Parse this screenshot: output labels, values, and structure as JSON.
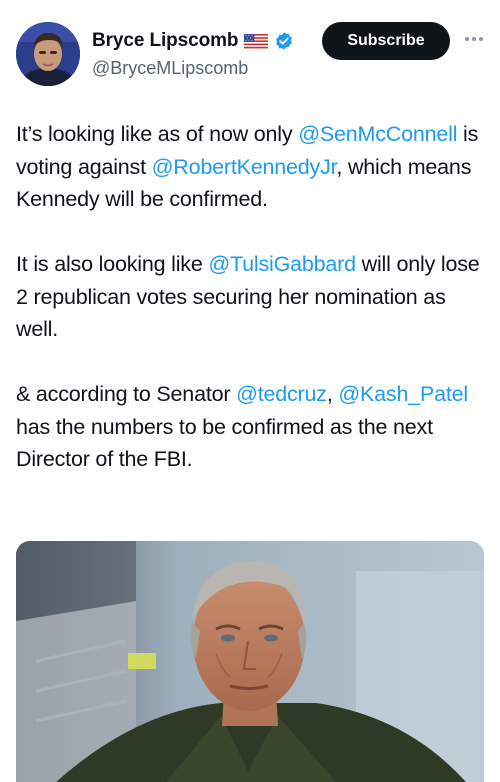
{
  "author": {
    "display_name": "Bryce Lipscomb",
    "handle": "@BryceMLipscomb",
    "flag_icon": "us-flag-icon",
    "verified_icon": "verified-badge-icon",
    "verified_color": "#1d9bf0"
  },
  "actions": {
    "subscribe_label": "Subscribe",
    "more_icon": "more-options-icon"
  },
  "tweet": {
    "paragraphs": [
      [
        {
          "text": "It’s looking like as of now only ",
          "mention": false
        },
        {
          "text": "@SenMcConnell",
          "mention": true
        },
        {
          "text": " is voting against ",
          "mention": false
        },
        {
          "text": "@RobertKennedyJr",
          "mention": true
        },
        {
          "text": ", which means Kennedy will be confirmed.",
          "mention": false
        }
      ],
      [
        {
          "text": "It is also looking like ",
          "mention": false
        },
        {
          "text": "@TulsiGabbard",
          "mention": true
        },
        {
          "text": " will only lose 2 republican votes securing her nomination as well.",
          "mention": false
        }
      ],
      [
        {
          "text": "& according to Senator ",
          "mention": false
        },
        {
          "text": "@tedcruz",
          "mention": true
        },
        {
          "text": ", ",
          "mention": false
        },
        {
          "text": "@Kash_Patel",
          "mention": true
        },
        {
          "text": " has the numbers to be confirmed as the next Director of the FBI.",
          "mention": false
        }
      ]
    ]
  },
  "colors": {
    "text": "#0f1419",
    "secondary": "#536471",
    "link": "#1d9bf0",
    "button_bg": "#0f1419"
  }
}
